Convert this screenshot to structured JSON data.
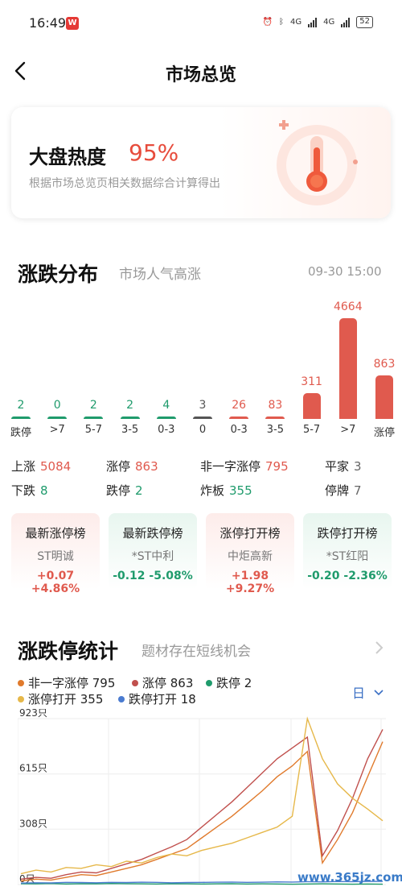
{
  "status_bar": {
    "time": "16:49",
    "app_badge": "W",
    "network_a": "4G",
    "network_b": "4G",
    "battery": "52"
  },
  "nav": {
    "title": "市场总览"
  },
  "heat": {
    "title": "大盘热度",
    "value": "95%",
    "subtitle": "根据市场总览页相关数据综合计算得出"
  },
  "distribution": {
    "title": "涨跌分布",
    "subtitle": "市场人气高涨",
    "time": "09-30 15:00",
    "bars": [
      {
        "label": "跌停",
        "value": 2,
        "color": "#1f9b6c"
      },
      {
        "label": ">7",
        "value": 0,
        "color": "#1f9b6c"
      },
      {
        "label": "5-7",
        "value": 2,
        "color": "#1f9b6c"
      },
      {
        "label": "3-5",
        "value": 2,
        "color": "#1f9b6c"
      },
      {
        "label": "0-3",
        "value": 4,
        "color": "#1f9b6c"
      },
      {
        "label": "0",
        "value": 3,
        "color": "#555555"
      },
      {
        "label": "0-3",
        "value": 26,
        "color": "#e05a4e"
      },
      {
        "label": "3-5",
        "value": 83,
        "color": "#e05a4e"
      },
      {
        "label": "5-7",
        "value": 311,
        "color": "#e05a4e"
      },
      {
        "label": ">7",
        "value": 4664,
        "color": "#e05a4e"
      },
      {
        "label": "涨停",
        "value": 863,
        "color": "#e05a4e"
      }
    ]
  },
  "stats": {
    "up_label": "上涨",
    "up_value": "5084",
    "limit_up_label": "涨停",
    "limit_up_value": "863",
    "non_one_label": "非一字涨停",
    "non_one_value": "795",
    "flat_label": "平家",
    "flat_value": "3",
    "down_label": "下跌",
    "down_value": "8",
    "limit_down_label": "跌停",
    "limit_down_value": "2",
    "broken_label": "炸板",
    "broken_value": "355",
    "suspend_label": "停牌",
    "suspend_value": "7"
  },
  "ranks": [
    {
      "title": "最新涨停榜",
      "name": "ST明诚",
      "value": "+0.07 +4.86%",
      "tone": "red"
    },
    {
      "title": "最新跌停榜",
      "name": "*ST中利",
      "value": "-0.12 -5.08%",
      "tone": "green"
    },
    {
      "title": "涨停打开榜",
      "name": "中炬高新",
      "value": "+1.98 +9.27%",
      "tone": "red"
    },
    {
      "title": "跌停打开榜",
      "name": "*ST红阳",
      "value": "-0.20 -2.36%",
      "tone": "green"
    }
  ],
  "stats_section": {
    "title": "涨跌停统计",
    "subtitle": "题材存在短线机会",
    "period": "日"
  },
  "legend": [
    {
      "label": "非一字涨停 795",
      "color": "#e07a2c"
    },
    {
      "label": "涨停 863",
      "color": "#c0504d"
    },
    {
      "label": "跌停 2",
      "color": "#1f9b6c"
    },
    {
      "label": "涨停打开 355",
      "color": "#e6b84a"
    },
    {
      "label": "跌停打开 18",
      "color": "#4a7bd0"
    }
  ],
  "chart_data": {
    "type": "line",
    "y_ticks": [
      "923只",
      "615只",
      "308只",
      "0只"
    ],
    "ylim": [
      0,
      923
    ],
    "series": [
      {
        "name": "非一字涨停",
        "color": "#e07a2c",
        "values": [
          20,
          30,
          25,
          40,
          55,
          50,
          70,
          90,
          110,
          140,
          170,
          200,
          260,
          320,
          380,
          450,
          520,
          600,
          660,
          740,
          120,
          250,
          400,
          600,
          795
        ]
      },
      {
        "name": "涨停",
        "color": "#c0504d",
        "values": [
          30,
          40,
          35,
          55,
          70,
          65,
          90,
          115,
          140,
          175,
          210,
          250,
          320,
          390,
          460,
          540,
          620,
          700,
          760,
          820,
          160,
          300,
          480,
          700,
          863
        ]
      },
      {
        "name": "跌停",
        "color": "#1f9b6c",
        "values": [
          5,
          4,
          6,
          3,
          5,
          4,
          6,
          5,
          4,
          3,
          5,
          4,
          3,
          4,
          5,
          3,
          4,
          3,
          2,
          3,
          4,
          3,
          2,
          3,
          2
        ]
      },
      {
        "name": "涨停打开",
        "color": "#e6b84a",
        "values": [
          60,
          80,
          70,
          95,
          90,
          110,
          100,
          130,
          120,
          150,
          170,
          160,
          190,
          210,
          230,
          260,
          290,
          320,
          380,
          923,
          700,
          560,
          480,
          420,
          355
        ]
      },
      {
        "name": "跌停打开",
        "color": "#4a7bd0",
        "values": [
          8,
          10,
          9,
          12,
          11,
          10,
          12,
          11,
          13,
          12,
          10,
          11,
          12,
          13,
          14,
          12,
          13,
          15,
          14,
          16,
          15,
          17,
          16,
          18,
          18
        ]
      }
    ]
  },
  "watermark": "www.365jz.com"
}
